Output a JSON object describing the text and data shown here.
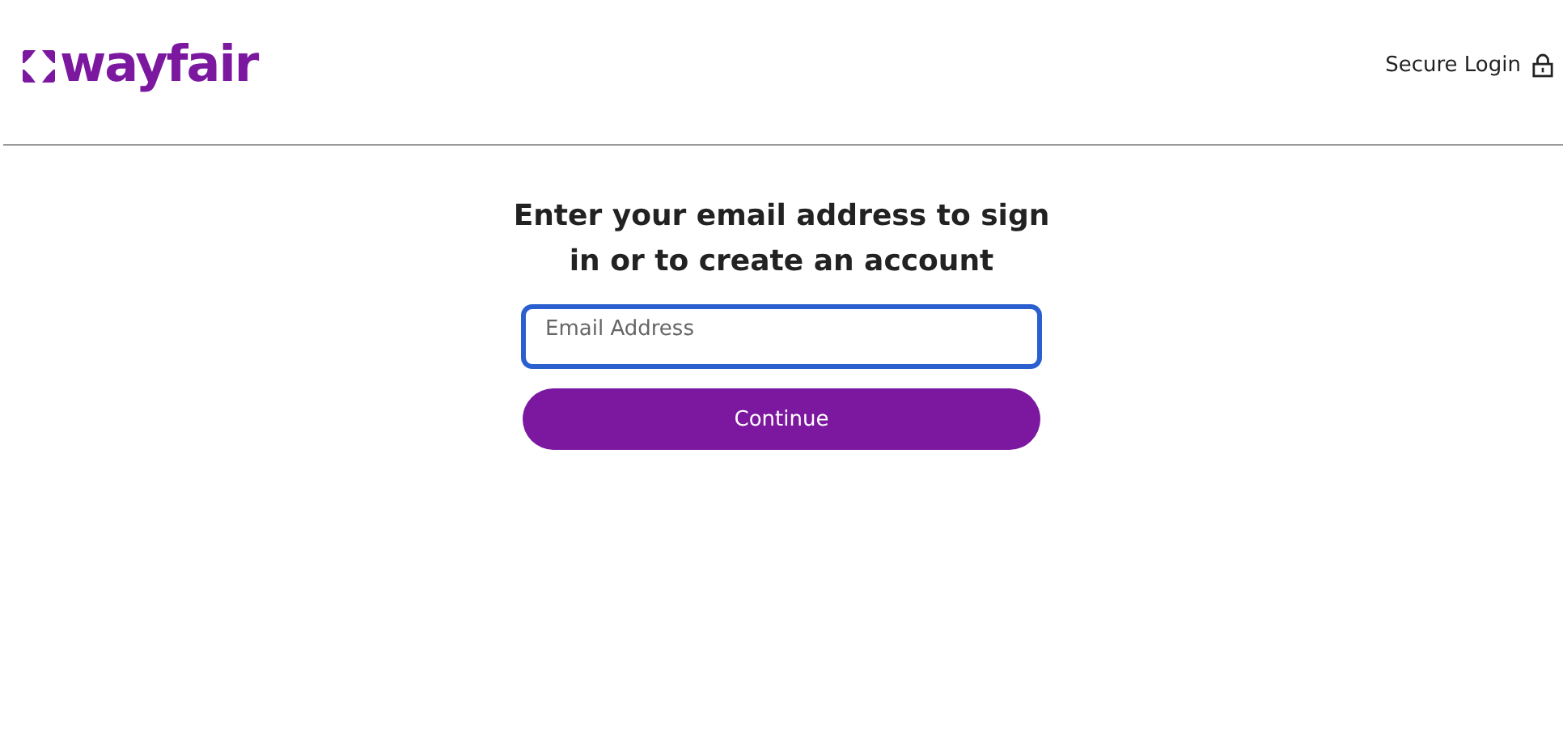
{
  "header": {
    "logo": {
      "wordmark": "wayfair"
    },
    "secure_login": "Secure Login"
  },
  "heading": "Enter your email address to sign in or to create an account",
  "email_field": {
    "placeholder": "Email Address",
    "focused": true
  },
  "continue_button": {
    "label": "Continue"
  }
}
